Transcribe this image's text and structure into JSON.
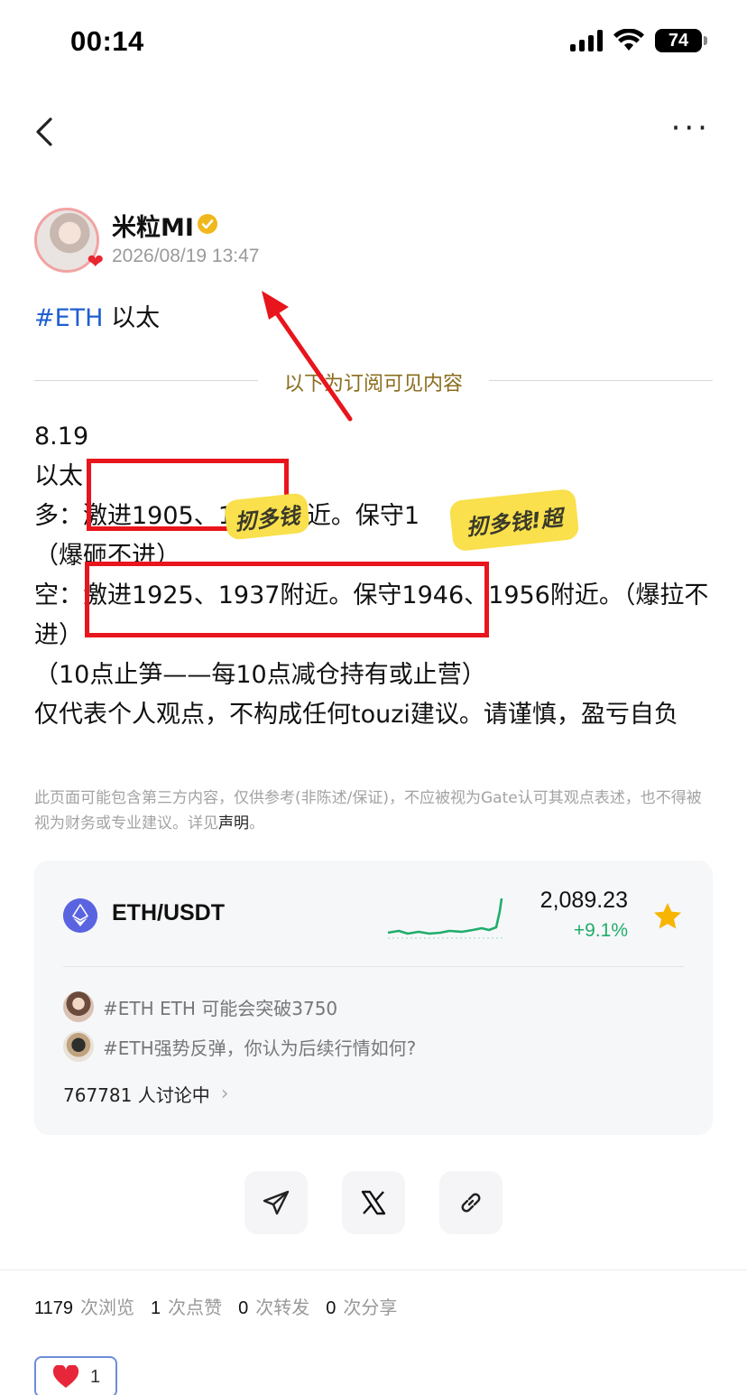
{
  "status_bar": {
    "time": "00:14",
    "battery": "74"
  },
  "author": {
    "name": "米粒MI",
    "time": "2026/08/19 13:47"
  },
  "topic": {
    "tag": "#ETH",
    "text": " 以太"
  },
  "divider_label": "以下为订阅可见内容",
  "post": {
    "lines": [
      "8.19",
      "以太",
      "多：激进1905、1    附近。保守1      2附近。",
      "（爆砸不进）",
      "空：激进1925、1937附近。保守1946、1956附近。（爆拉不进）",
      "（10点止笋——每10点减仓持有或止营）",
      "仅代表个人观点，不构成任何touzi建议。请谨慎，盈亏自负"
    ]
  },
  "overlays": {
    "mark1": "扨多钱",
    "mark2": "扨多钱!超"
  },
  "disclaimer": {
    "text": "此页面可能包含第三方内容，仅供参考(非陈述/保证)，不应被视为Gate认可其观点表述，也不得被视为财务或专业建议。详见",
    "link": "声明",
    "end": "。"
  },
  "market": {
    "pair": "ETH/USDT",
    "price": "2,089.23",
    "change": "+9.1%",
    "colors": {
      "up": "#1fad6b",
      "star": "#f7b500"
    },
    "discussions": [
      "#ETH ETH 可能会突破3750",
      "#ETH强势反弹，你认为后续行情如何?"
    ],
    "discussing": "767781 人讨论中"
  },
  "stats": [
    {
      "num": "1179",
      "label": "次浏览"
    },
    {
      "num": "1",
      "label": "次点赞"
    },
    {
      "num": "0",
      "label": "次转发"
    },
    {
      "num": "0",
      "label": "次分享"
    }
  ],
  "like": {
    "count": "1"
  }
}
